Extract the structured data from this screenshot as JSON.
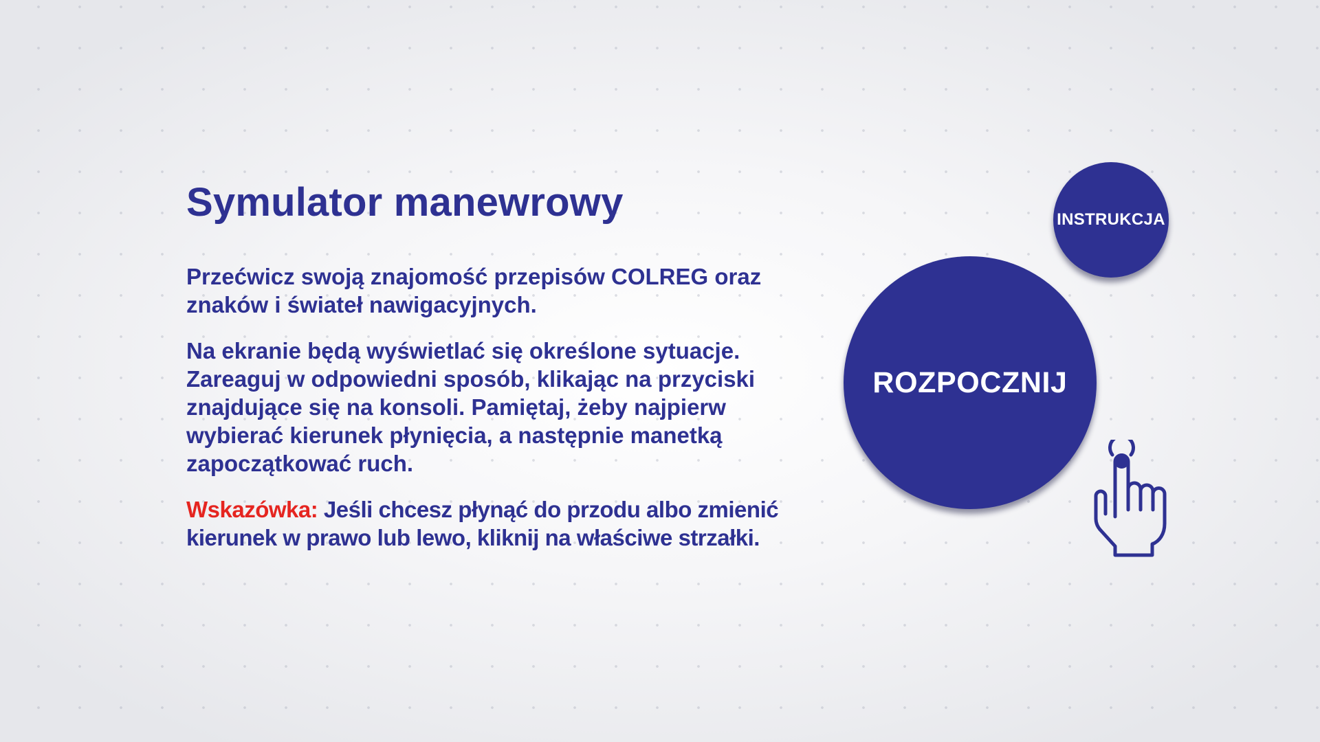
{
  "header": {
    "title": "Symulator manewrowy"
  },
  "description": {
    "paragraph1": "Przećwicz swoją znajomość przepisów COLREG oraz znaków i świateł nawigacyjnych.",
    "paragraph2": "Na ekranie będą wyświetlać się określone sytuacje. Zareaguj w odpowiedni sposób, klikając na przyciski znajdujące się na konsoli. Pamiętaj, żeby najpierw wybierać kierunek płynięcia, a następnie manetką zapoczątkować ruch.",
    "hint_label": "Wskazówka:",
    "hint_text": " Jeśli chcesz płynąć do przodu albo zmienić kierunek w prawo lub lewo, kliknij na właściwe strzałki."
  },
  "buttons": {
    "instruction_label": "INSTRUKCJA",
    "start_label": "ROZPOCZNIJ"
  },
  "icons": {
    "pointer": "tap-hand-icon"
  },
  "colors": {
    "primary": "#2e3192",
    "accent": "#e52520",
    "button_text": "#ffffff"
  }
}
